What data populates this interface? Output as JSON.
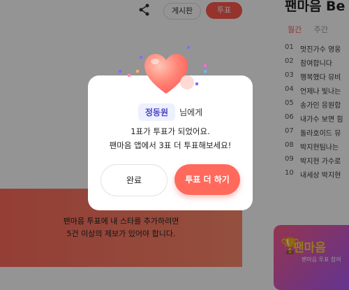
{
  "header": {
    "board_label": "게시판",
    "vote_label": "투표"
  },
  "ranking": {
    "title": "팬마음 Be",
    "tabs": [
      "월간",
      "주간"
    ],
    "items": [
      {
        "no": "01",
        "text": "멋진가수 영웅"
      },
      {
        "no": "02",
        "text": "참여합니다"
      },
      {
        "no": "03",
        "text": "행복했다 뮤비"
      },
      {
        "no": "04",
        "text": "언제나 빛나는"
      },
      {
        "no": "05",
        "text": "송가인 응원합"
      },
      {
        "no": "06",
        "text": "내가수 보면 힘"
      },
      {
        "no": "07",
        "text": "돌라호이드 뮤"
      },
      {
        "no": "08",
        "text": "박지현팀나는"
      },
      {
        "no": "09",
        "text": "박지현 가수로"
      },
      {
        "no": "10",
        "text": "내세상 박지현"
      }
    ]
  },
  "banner": {
    "line1": "팬마음 투표에 내 스타를 추가하려면",
    "line2": "5건 이상의 제보가 있어야 합니다."
  },
  "ad": {
    "title": "팬마음",
    "subtitle": "팬마음 투표 참여"
  },
  "modal": {
    "recipient": "정동원",
    "recipient_suffix": "님에게",
    "message_line1": "1표가 투표가 되었어요.",
    "message_line2": "팬마음 앱에서 3표 더 투표해보세요!",
    "done_label": "완료",
    "more_label": "투표 더 하기"
  },
  "colors": {
    "accent": "#ff6a5c",
    "recipient_text": "#4a44c8",
    "recipient_bg": "#eef0ff"
  }
}
